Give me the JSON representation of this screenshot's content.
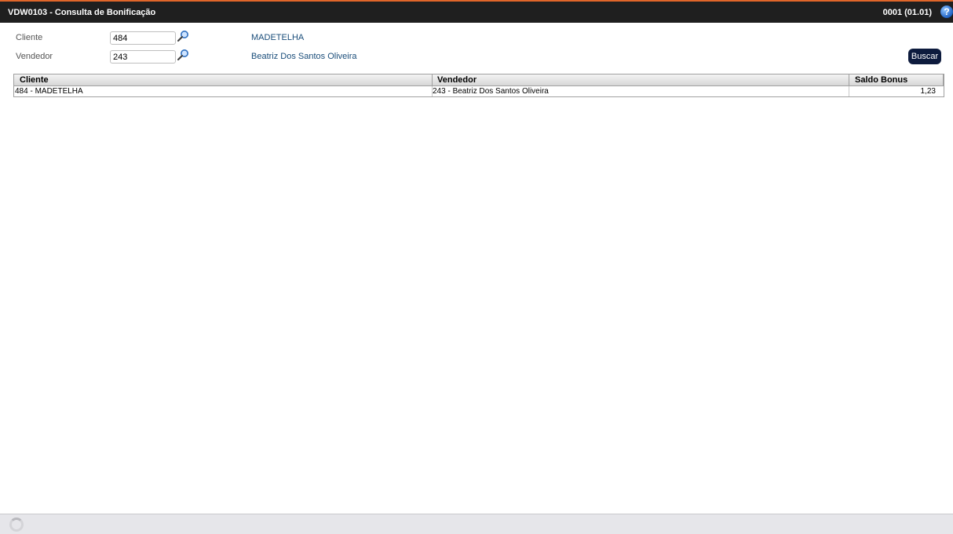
{
  "window": {
    "title": "VDW0103 - Consulta de Bonificação",
    "company": "0001 (01.01)",
    "help_icon": "question-icon"
  },
  "filters": {
    "cliente": {
      "label": "Cliente",
      "value": "484",
      "description": "MADETELHA"
    },
    "vendedor": {
      "label": "Vendedor",
      "value": "243",
      "description": "Beatriz Dos Santos Oliveira"
    },
    "lookup_icon": "magnifier-icon"
  },
  "actions": {
    "buscar_label": "Buscar"
  },
  "grid": {
    "columns": [
      "Cliente",
      "Vendedor",
      "Saldo Bonus"
    ],
    "rows": [
      {
        "cliente": "484 - MADETELHA",
        "vendedor": "243 - Beatriz Dos Santos Oliveira",
        "saldo_bonus": "1,23"
      }
    ]
  },
  "colors": {
    "titlebar": "#1f1f1f",
    "accent": "#e0662a",
    "button": "#0d1b3d",
    "description": "#1a4d7a"
  }
}
